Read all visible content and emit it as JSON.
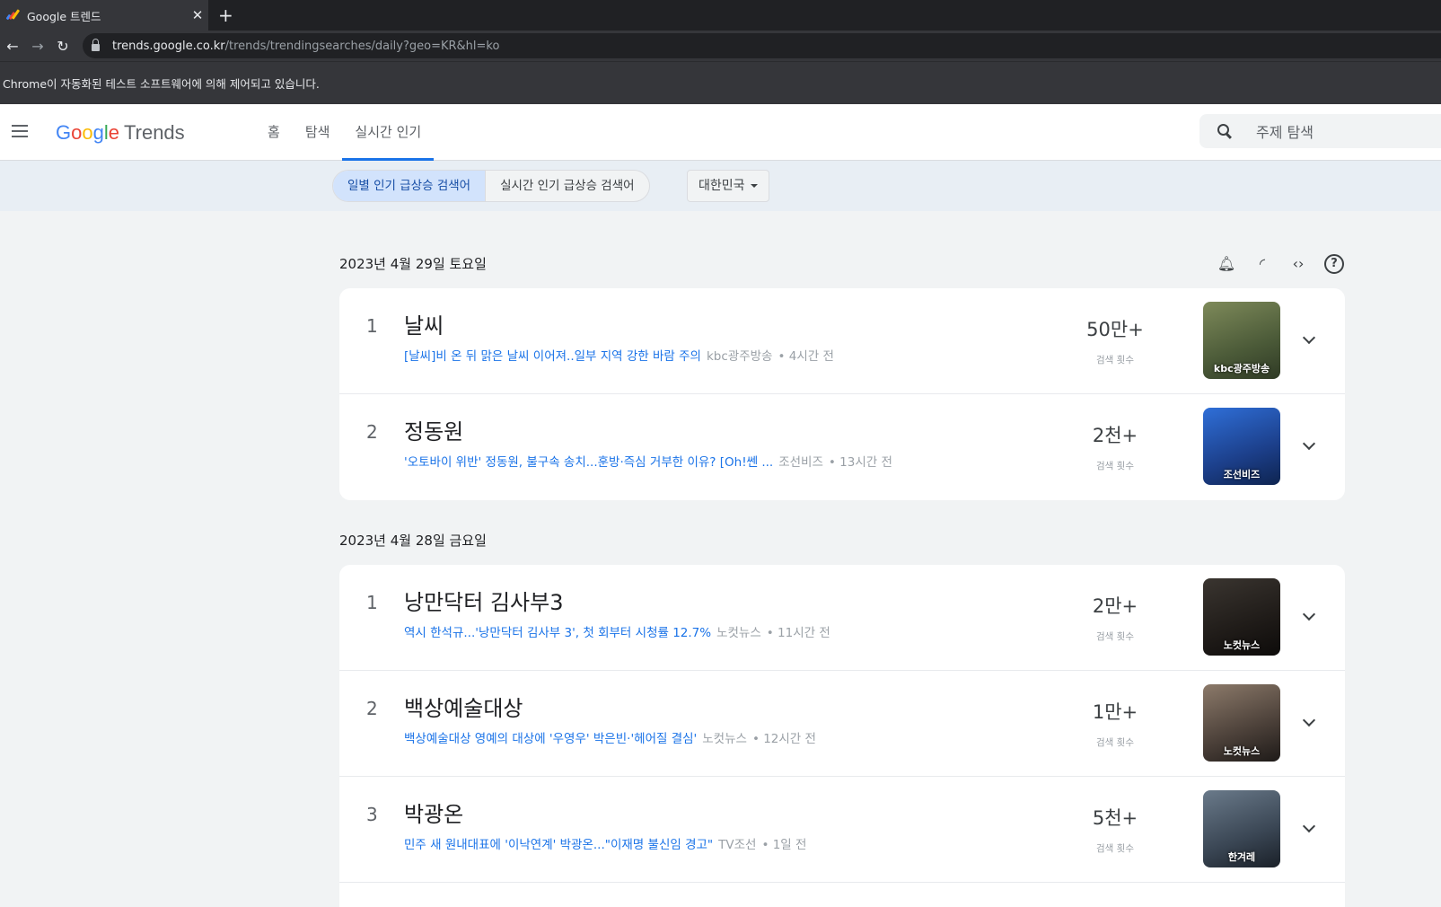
{
  "browser": {
    "tab_title": "Google 트렌드",
    "url_host": "trends.google.co.kr",
    "url_path": "/trends/trendingsearches/daily?geo=KR&hl=ko",
    "infobar": "Chrome이 자동화된 테스트 소프트웨어에 의해 제어되고 있습니다."
  },
  "header": {
    "logo_trends": "Trends",
    "nav": [
      "홈",
      "탐색",
      "실시간 인기"
    ],
    "search_placeholder": "주제 탐색"
  },
  "filters": {
    "daily": "일별 인기 급상승 검색어",
    "realtime": "실시간 인기 급상승 검색어",
    "country": "대한민국"
  },
  "groups": [
    {
      "date": "2023년 4월 29일 토요일",
      "items": [
        {
          "rank": "1",
          "query": "날씨",
          "headline": "[날씨]비 온 뒤 맑은 날씨 이어져..일부 지역 강한 바람 주의",
          "source": "kbc광주방송",
          "time": "4시간 전",
          "count": "50만+",
          "count_label": "검색 횟수",
          "thumb_label": "kbc광주방송"
        },
        {
          "rank": "2",
          "query": "정동원",
          "headline": "'오토바이 위반' 정동원, 불구속 송치...훈방·즉심 거부한 이유? [Oh!쎈 ...",
          "source": "조선비즈",
          "time": "13시간 전",
          "count": "2천+",
          "count_label": "검색 횟수",
          "thumb_label": "조선비즈"
        }
      ]
    },
    {
      "date": "2023년 4월 28일 금요일",
      "items": [
        {
          "rank": "1",
          "query": "낭만닥터 김사부3",
          "headline": "역시 한석규...'낭만닥터 김사부 3', 첫 회부터 시청률 12.7%",
          "source": "노컷뉴스",
          "time": "11시간 전",
          "count": "2만+",
          "count_label": "검색 횟수",
          "thumb_label": "노컷뉴스"
        },
        {
          "rank": "2",
          "query": "백상예술대상",
          "headline": "백상예술대상 영예의 대상에 '우영우' 박은빈·'헤어질 결심'",
          "source": "노컷뉴스",
          "time": "12시간 전",
          "count": "1만+",
          "count_label": "검색 횟수",
          "thumb_label": "노컷뉴스"
        },
        {
          "rank": "3",
          "query": "박광온",
          "headline": "민주 새 원내대표에 '이낙연계' 박광온...\"이재명 불신임 경고\"",
          "source": "TV조선",
          "time": "1일 전",
          "count": "5천+",
          "count_label": "검색 횟수",
          "thumb_label": "한겨레"
        }
      ]
    }
  ],
  "colors": {
    "accent": "#1a73e8",
    "selected_bg": "#d2e3fc"
  }
}
